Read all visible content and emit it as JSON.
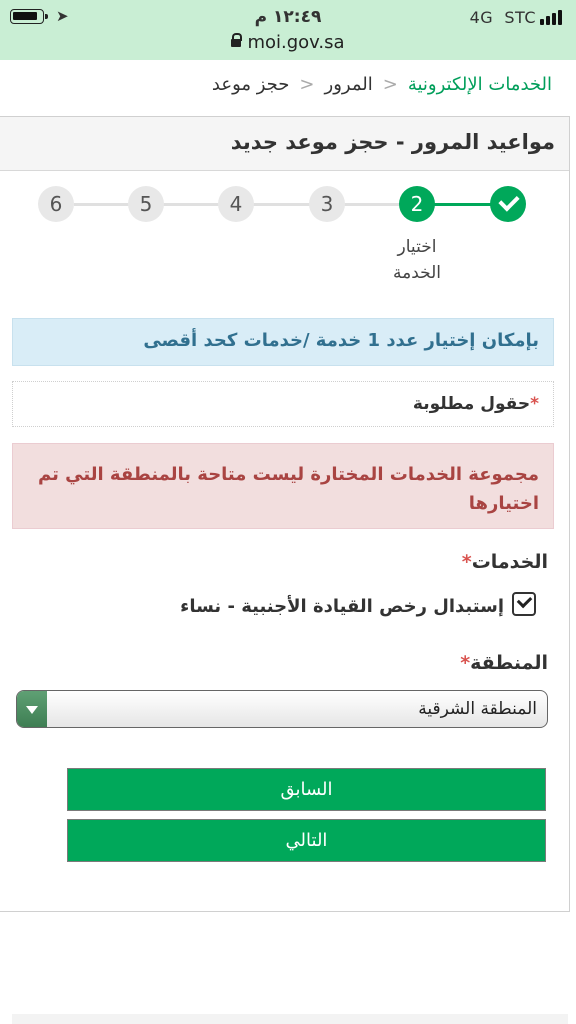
{
  "status_bar": {
    "time": "١٢:٤٩ م",
    "network": "4G",
    "carrier": "STC",
    "url": "moi.gov.sa"
  },
  "breadcrumb": {
    "items": [
      "الخدمات الإلكترونية",
      "المرور",
      "حجز موعد"
    ]
  },
  "page": {
    "title": "مواعيد المرور - حجز موعد جديد"
  },
  "stepper": {
    "steps": [
      "✓",
      "2",
      "3",
      "4",
      "5",
      "6"
    ],
    "active_label_line1": "اختيار",
    "active_label_line2": "الخدمة"
  },
  "info_message": "بإمكان إختيار عدد 1 خدمة /خدمات كحد أقصى",
  "required_note": "حقول مطلوبة",
  "error_message": "مجموعة الخدمات المختارة ليست متاحة بالمنطقة التي تم اختيارها",
  "form": {
    "services_label": "الخدمات",
    "service_option": "إستبدال رخص القيادة الأجنبية - نساء",
    "service_checked": true,
    "region_label": "المنطقة",
    "region_value": "المنطقة الشرقية"
  },
  "buttons": {
    "previous": "السابق",
    "next": "التالي"
  },
  "colors": {
    "accent": "#00a85a",
    "info_bg": "#d9edf7",
    "error_bg": "#f2dede",
    "status_bar_bg": "#c9eed4"
  }
}
